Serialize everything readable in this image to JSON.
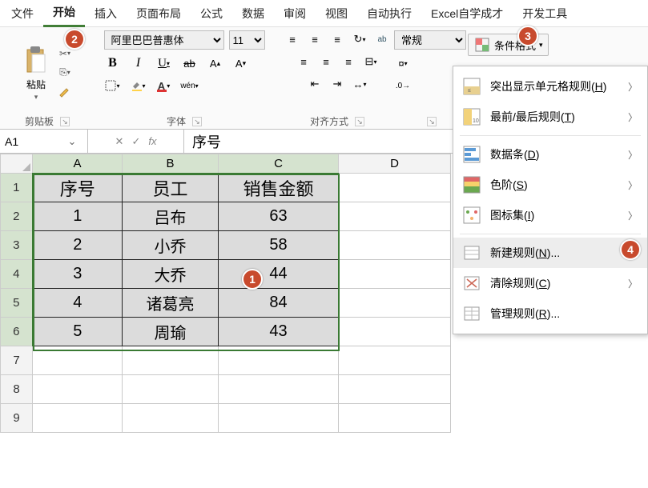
{
  "tabs": [
    "文件",
    "开始",
    "插入",
    "页面布局",
    "公式",
    "数据",
    "审阅",
    "视图",
    "自动执行",
    "Excel自学成才",
    "开发工具"
  ],
  "active_tab": "开始",
  "ribbon": {
    "clipboard": {
      "paste": "粘贴",
      "label": "剪贴板"
    },
    "font": {
      "name": "阿里巴巴普惠体",
      "size": "11",
      "label": "字体"
    },
    "align": {
      "label": "对齐方式"
    },
    "number": {
      "format": "常规"
    },
    "cf_button": "条件格式"
  },
  "namebox": "A1",
  "formula": "序号",
  "cols": [
    "A",
    "B",
    "C",
    "D"
  ],
  "rows": [
    "1",
    "2",
    "3",
    "4",
    "5",
    "6",
    "7",
    "8",
    "9"
  ],
  "table": {
    "headers": [
      "序号",
      "员工",
      "销售金额"
    ],
    "data": [
      [
        "1",
        "吕布",
        "63"
      ],
      [
        "2",
        "小乔",
        "58"
      ],
      [
        "3",
        "大乔",
        "44"
      ],
      [
        "4",
        "诸葛亮",
        "84"
      ],
      [
        "5",
        "周瑜",
        "43"
      ]
    ]
  },
  "menu": {
    "highlight": "突出显示单元格规则",
    "highlight_hot": "H",
    "toplast": "最前/最后规则",
    "toplast_hot": "T",
    "databar": "数据条",
    "databar_hot": "D",
    "colorscale": "色阶",
    "colorscale_hot": "S",
    "iconset": "图标集",
    "iconset_hot": "I",
    "newrule": "新建规则",
    "newrule_hot": "N",
    "clear": "清除规则",
    "clear_hot": "C",
    "manage": "管理规则",
    "manage_hot": "R"
  },
  "callouts": {
    "c1": "1",
    "c2": "2",
    "c3": "3",
    "c4": "4"
  }
}
